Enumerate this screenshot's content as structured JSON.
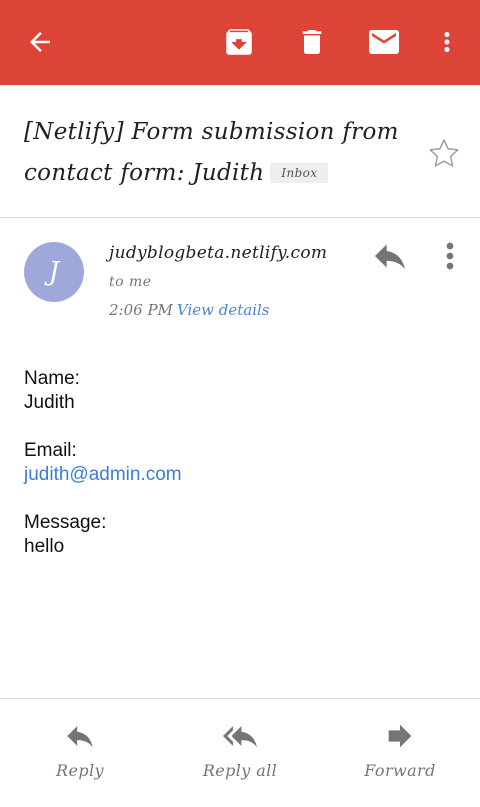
{
  "toolbar": {
    "bg_color": "#db4437",
    "icons": [
      "back-arrow-icon",
      "archive-icon",
      "trash-icon",
      "mail-icon",
      "more-vert-icon"
    ]
  },
  "message": {
    "subject": "[Netlify] Form submission from contact form: Judith",
    "label": "Inbox",
    "sender": "judyblogbeta.netlify.com",
    "avatar_letter": "J",
    "avatar_color": "#9fa8da",
    "recipient": "to me",
    "time": "2:06 PM",
    "view_details": "View details"
  },
  "body": {
    "name_label": "Name:",
    "name_value": "Judith",
    "email_label": "Email:",
    "email_value": "judith@admin.com",
    "message_label": "Message:",
    "message_value": "hello"
  },
  "actions": {
    "reply": "Reply",
    "reply_all": "Reply all",
    "forward": "Forward"
  }
}
